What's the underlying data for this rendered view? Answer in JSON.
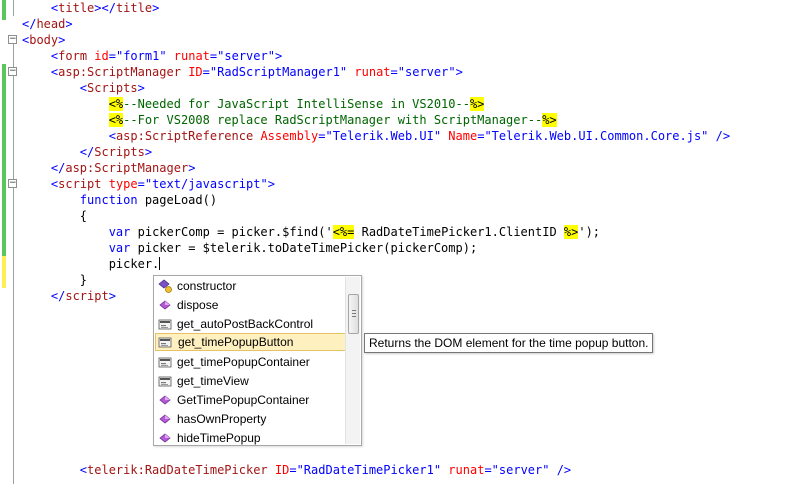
{
  "colors": {
    "gutter_green": "#5cc55c",
    "gutter_yellow": "#ffee55",
    "tag_blue": "#0000ff",
    "element_maroon": "#a31515",
    "attribute_red": "#ff0000",
    "server_tag_highlight": "#ffff00",
    "selected_item": "#fff0c0"
  },
  "code": {
    "l1": {
      "indent": "    ",
      "a": "<",
      "b": "title",
      "c": "></",
      "d": "title",
      "e": ">"
    },
    "l2": {
      "a": "</",
      "b": "head",
      "c": ">"
    },
    "l3": {
      "a": "<",
      "b": "body",
      "c": ">"
    },
    "l4": {
      "indent": "    ",
      "a": "<",
      "b": "form",
      "c": " id",
      "d": "=",
      "e": "\"form1\"",
      "f": " runat",
      "g": "=",
      "h": "\"server\"",
      "i": ">"
    },
    "l5": {
      "indent": "    ",
      "a": "<",
      "b": "asp:ScriptManager",
      "c": " ID",
      "d": "=",
      "e": "\"RadScriptManager1\"",
      "f": " runat",
      "g": "=",
      "h": "\"server\"",
      "i": ">"
    },
    "l6": {
      "indent": "        ",
      "a": "<",
      "b": "Scripts",
      "c": ">"
    },
    "l7": {
      "indent": "            ",
      "a": "<%",
      "b": "--Needed for JavaScript IntelliSense in VS2010--",
      "c": "%>"
    },
    "l8": {
      "indent": "            ",
      "a": "<%",
      "b": "--For VS2008 replace RadScriptManager with ScriptManager--",
      "c": "%>"
    },
    "l9": {
      "indent": "            ",
      "a": "<",
      "b": "asp:ScriptReference",
      "c": " Assembly",
      "d": "=",
      "e": "\"Telerik.Web.UI\"",
      "f": " Name",
      "g": "=",
      "h": "\"Telerik.Web.UI.Common.Core.js\"",
      "i": " />"
    },
    "l10": {
      "indent": "        ",
      "a": "</",
      "b": "Scripts",
      "c": ">"
    },
    "l11": {
      "indent": "    ",
      "a": "</",
      "b": "asp:ScriptManager",
      "c": ">"
    },
    "l12": {
      "indent": "    ",
      "a": "<",
      "b": "script",
      "c": " type",
      "d": "=",
      "e": "\"text/javascript\"",
      "f": ">"
    },
    "l13": {
      "indent": "        ",
      "a": "function",
      "b": " pageLoad()"
    },
    "l14": {
      "indent": "        ",
      "a": "{"
    },
    "l15": {
      "indent": "            ",
      "a": "var",
      "b": " pickerComp = picker.$find('",
      "c": "<%=",
      "d": " RadDateTimePicker1.ClientID ",
      "e": "%>",
      "f": "');"
    },
    "l16": {
      "indent": "            ",
      "a": "var",
      "b": " picker = $telerik.toDateTimePicker(pickerComp);"
    },
    "l17": {
      "indent": "            ",
      "a": "picker."
    },
    "l18": {
      "indent": "        ",
      "a": "}"
    },
    "l19": {
      "indent": "    ",
      "a": "</",
      "b": "script",
      "c": ">"
    },
    "l20": {
      "indent": "        ",
      "a": "<",
      "b": "telerik:RadDateTimePicker",
      "c": " ID",
      "d": "=",
      "e": "\"RadDateTimePicker1\"",
      "f": " runat",
      "g": "=",
      "h": "\"server\"",
      "i": " />"
    }
  },
  "fold_markers": {
    "open": "−"
  },
  "intellisense": {
    "items": [
      {
        "label": "constructor",
        "icon": "constructor-icon"
      },
      {
        "label": "dispose",
        "icon": "method-icon"
      },
      {
        "label": "get_autoPostBackControl",
        "icon": "property-icon"
      },
      {
        "label": "get_timePopupButton",
        "icon": "property-icon"
      },
      {
        "label": "get_timePopupContainer",
        "icon": "property-icon"
      },
      {
        "label": "get_timeView",
        "icon": "property-icon"
      },
      {
        "label": "GetTimePopupContainer",
        "icon": "method-icon"
      },
      {
        "label": "hasOwnProperty",
        "icon": "method-icon"
      },
      {
        "label": "hideTimePopup",
        "icon": "method-icon"
      }
    ],
    "selected": "get_timePopupButton",
    "tooltip": "Returns the DOM element for the time popup button."
  }
}
